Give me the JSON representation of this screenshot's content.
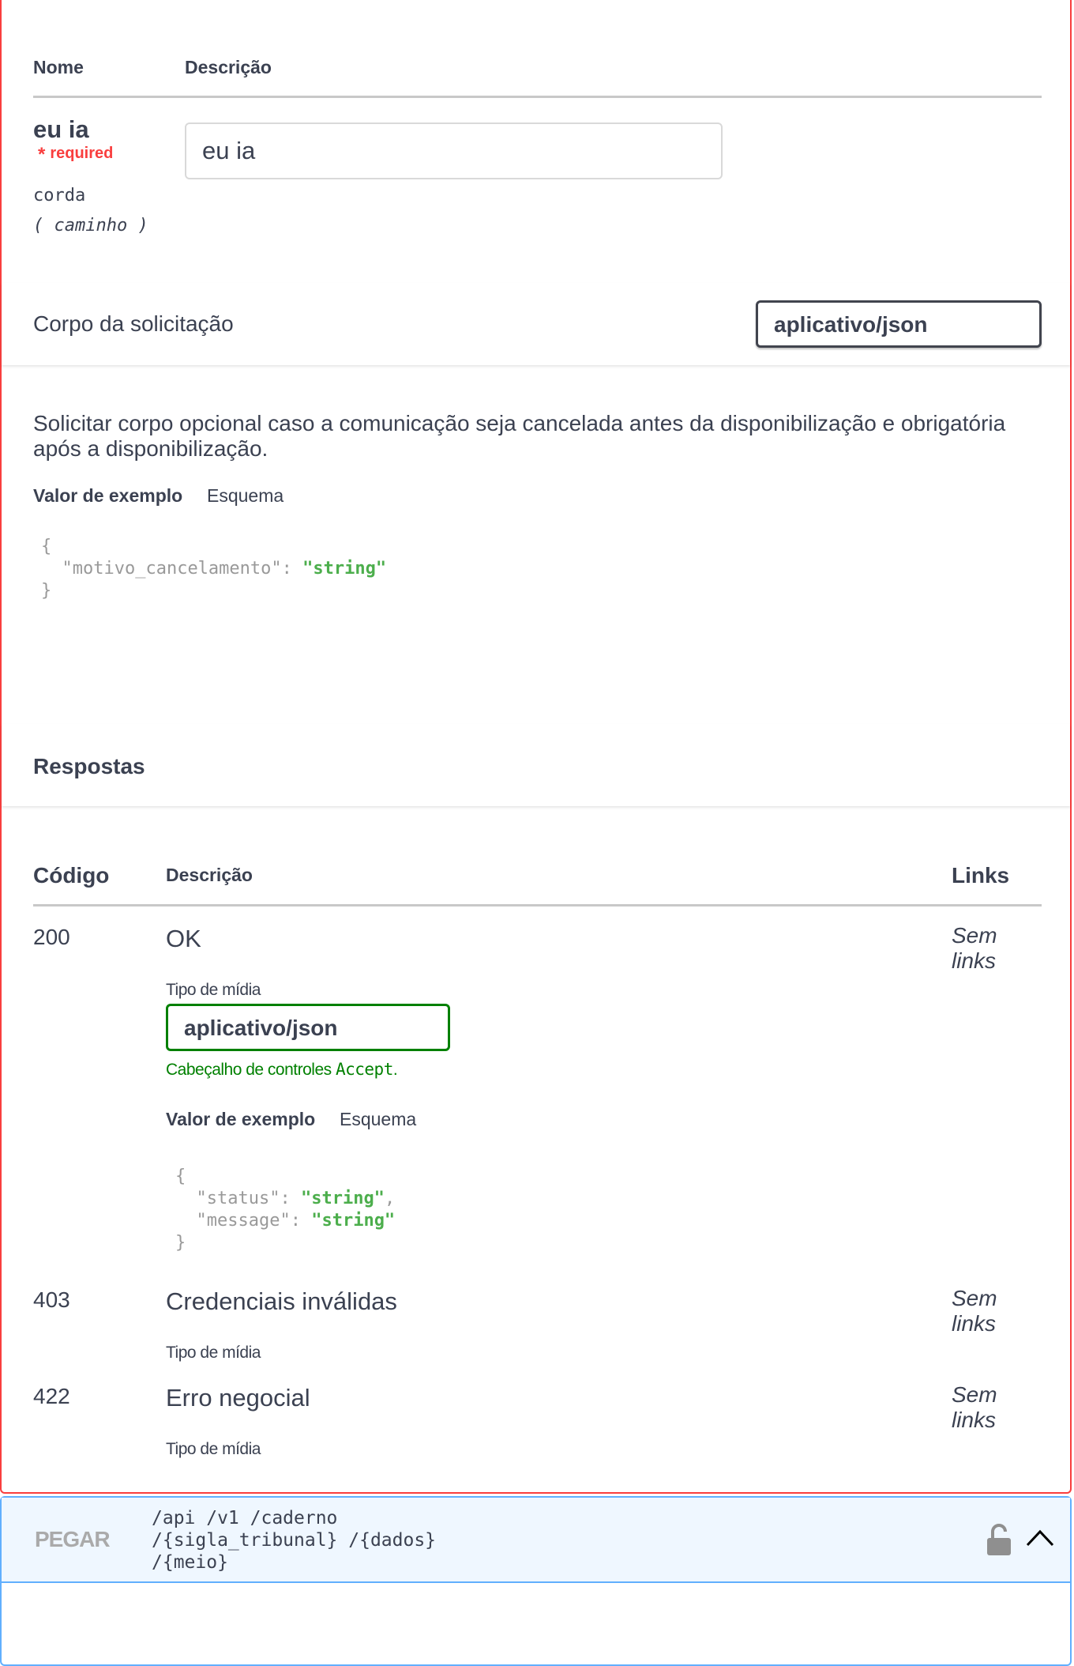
{
  "parameters": {
    "col_name": "Nome",
    "col_description": "Descrição",
    "param": {
      "name": "eu ia",
      "required_label": "required",
      "type": "corda",
      "location": "( caminho )",
      "value": "eu ia"
    }
  },
  "request_body": {
    "title": "Corpo da solicitação",
    "content_type": "aplicativo/json",
    "description": "Solicitar corpo opcional caso a comunicação seja cancelada antes da disponibilização e obrigatória após a disponibilização.",
    "tab_example": "Valor de exemplo",
    "tab_schema": "Esquema",
    "example_json": {
      "open": "{",
      "key1": "\"motivo_cancelamento\"",
      "val1": "\"string\"",
      "close": "}"
    }
  },
  "responses": {
    "title": "Respostas",
    "col_code": "Código",
    "col_description": "Descrição",
    "col_links": "Links",
    "media_type_label": "Tipo de mídia",
    "no_links_line1": "Sem",
    "no_links_line2": "links",
    "rows": [
      {
        "code": "200",
        "description": "OK",
        "media_type": "aplicativo/json",
        "controls_text": "Cabeçalho de controles ",
        "controls_code": "Accept",
        "controls_end": ".",
        "tab_example": "Valor de exemplo",
        "tab_schema": "Esquema",
        "example_json": {
          "open": "{",
          "key1": "\"status\"",
          "val1": "\"string\"",
          "key2": "\"message\"",
          "val2": "\"string\"",
          "close": "}"
        }
      },
      {
        "code": "403",
        "description": "Credenciais inválidas"
      },
      {
        "code": "422",
        "description": "Erro negocial"
      }
    ]
  },
  "next_operation": {
    "method": "PEGAR",
    "path_line1": "/api /v1 /caderno",
    "path_line2": "/{sigla_tribunal} /{dados}",
    "path_line3": "/{meio}",
    "lock_icon": "unlocked-padlock-icon",
    "toggle_icon": "chevron-up-icon"
  },
  "colors": {
    "delete_border": "#f93e3e",
    "get_border": "#61affe",
    "get_background": "#eff7ff",
    "text": "#3b4151",
    "json_string": "#4cae4c",
    "accept_green": "#008000"
  }
}
